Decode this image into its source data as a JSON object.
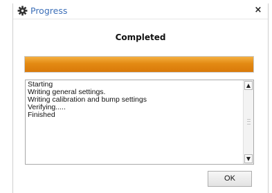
{
  "window": {
    "title": "Progress",
    "title_icon": "gear-icon",
    "close_glyph": "×",
    "close_icon": "close-icon"
  },
  "status": {
    "heading": "Completed"
  },
  "progress": {
    "fraction": 1.0,
    "color": "#e38a13"
  },
  "log": {
    "lines": [
      "Starting",
      "Writing general settings.",
      "Writing calibration and bump settings",
      "Verifying.....",
      "Finished"
    ]
  },
  "buttons": {
    "ok_label": "OK"
  }
}
